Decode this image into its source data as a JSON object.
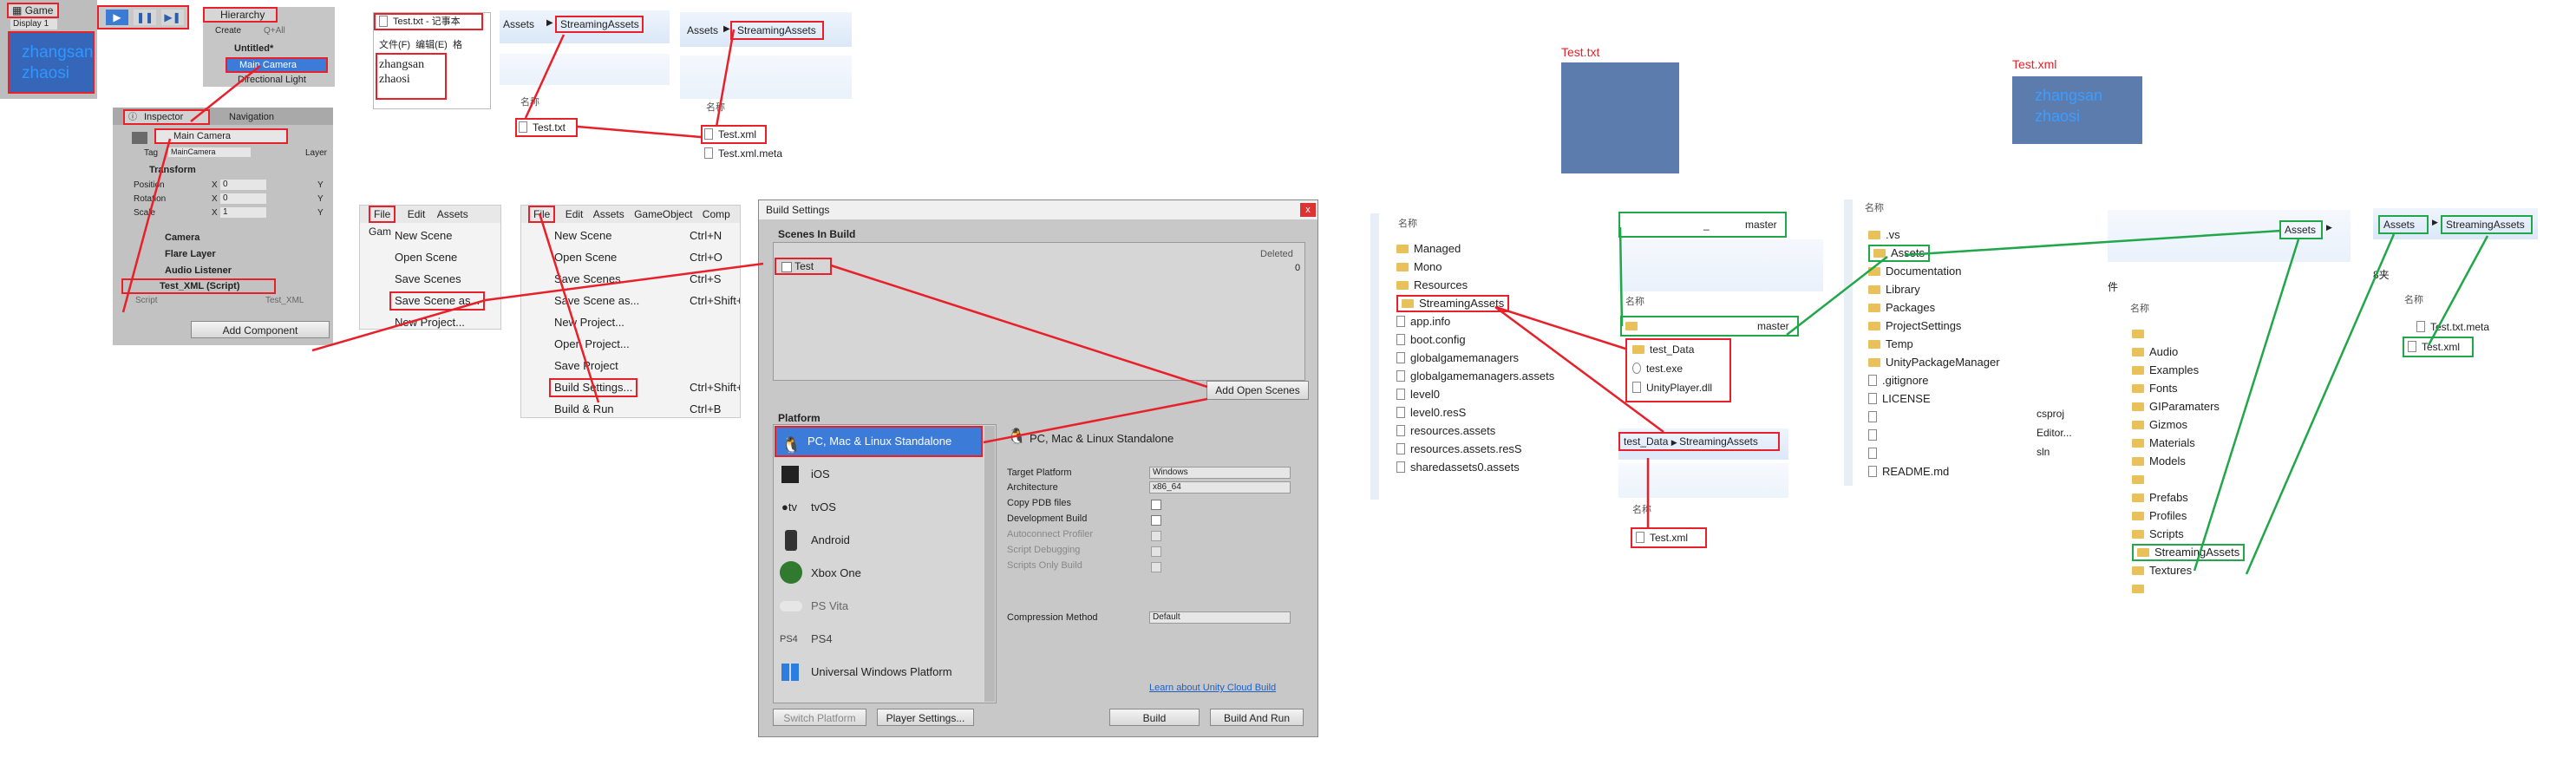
{
  "game": {
    "tab_label": "Game",
    "display_label": "Display 1",
    "text_lines": [
      "zhangsan",
      "zhaosi"
    ]
  },
  "hierarchy": {
    "title": "Hierarchy",
    "create_label": "Create",
    "search_label": "Q+All",
    "scene_name": "Untitled*",
    "items": [
      "Main Camera",
      "Directional Light"
    ]
  },
  "inspector": {
    "tabs": [
      "Inspector",
      "Navigation"
    ],
    "object_name": "Main Camera",
    "tag_label": "Tag",
    "tag_value": "MainCamera",
    "layer_label": "Layer",
    "transform_label": "Transform",
    "transform_rows": [
      {
        "label": "Position",
        "x": "0",
        "y": "Y"
      },
      {
        "label": "Rotation",
        "x": "0",
        "y": "Y"
      },
      {
        "label": "Scale",
        "x": "1",
        "y": "Y"
      }
    ],
    "x_label": "X",
    "components": [
      "Camera",
      "Flare Layer",
      "Audio Listener",
      "Test_XML (Script)"
    ],
    "script_label": "Script",
    "script_value": "Test_XML",
    "add_component_label": "Add Component"
  },
  "notepad": {
    "title": "Test.txt - 记事本",
    "menu": [
      "文件(F)",
      "编辑(E)",
      "格"
    ],
    "lines": [
      "zhangsan",
      "zhaosi"
    ]
  },
  "explorer_a": {
    "breadcrumb": [
      "Assets",
      "StreamingAssets"
    ],
    "column_label": "名称",
    "files": [
      "Test.txt"
    ]
  },
  "explorer_b": {
    "breadcrumb": [
      "Assets",
      "StreamingAssets"
    ],
    "column_label": "名称",
    "files": [
      "Test.xml",
      "Test.xml.meta"
    ]
  },
  "file_menu_a": {
    "menubar": [
      "File",
      "Edit",
      "Assets",
      "Gam"
    ],
    "items": [
      "New Scene",
      "Open Scene",
      "Save Scenes",
      "Save Scene as...",
      "New Project..."
    ]
  },
  "file_menu_b": {
    "menubar": [
      "File",
      "Edit",
      "Assets",
      "GameObject",
      "Comp"
    ],
    "items": [
      {
        "label": "New Scene",
        "shortcut": "Ctrl+N"
      },
      {
        "label": "Open Scene",
        "shortcut": "Ctrl+O"
      },
      {
        "label": "Save Scenes",
        "shortcut": "Ctrl+S"
      },
      {
        "label": "Save Scene as...",
        "shortcut": "Ctrl+Shift+S"
      },
      {
        "label": "New Project...",
        "shortcut": ""
      },
      {
        "label": "Open Project...",
        "shortcut": ""
      },
      {
        "label": "Save Project",
        "shortcut": ""
      },
      {
        "label": "Build Settings...",
        "shortcut": "Ctrl+Shift+B"
      },
      {
        "label": "Build & Run",
        "shortcut": "Ctrl+B"
      }
    ]
  },
  "build_settings": {
    "title": "Build Settings",
    "close_label": "x",
    "scenes_header": "Scenes In Build",
    "deleted_label": "Deleted",
    "scene_entry": "Test",
    "scene_index": "0",
    "add_open_scenes_label": "Add Open Scenes",
    "platform_header": "Platform",
    "platforms": [
      {
        "label": "PC, Mac & Linux Standalone",
        "icon": "pc-icon"
      },
      {
        "label": "iOS",
        "icon": "ios-icon"
      },
      {
        "label": "tvOS",
        "icon": "tvos-icon"
      },
      {
        "label": "Android",
        "icon": "android-icon"
      },
      {
        "label": "Xbox One",
        "icon": "xbox-icon"
      },
      {
        "label": "PS Vita",
        "icon": "psvita-icon"
      },
      {
        "label": "PS4",
        "icon": "ps4-icon"
      },
      {
        "label": "Universal Windows Platform",
        "icon": "windows-icon"
      }
    ],
    "selected_platform_title": "PC, Mac & Linux Standalone",
    "settings": [
      {
        "label": "Target Platform",
        "value": "Windows"
      },
      {
        "label": "Architecture",
        "value": "x86_64"
      },
      {
        "label": "Copy PDB files",
        "value": ""
      },
      {
        "label": "Development Build",
        "value": ""
      },
      {
        "label": "Autoconnect Profiler",
        "value": ""
      },
      {
        "label": "Script Debugging",
        "value": ""
      },
      {
        "label": "Scripts Only Build",
        "value": ""
      }
    ],
    "compression_label": "Compression Method",
    "compression_value": "Default",
    "cloud_link": "Learn about Unity Cloud Build",
    "switch_platform_label": "Switch Platform",
    "player_settings_label": "Player Settings...",
    "build_label": "Build",
    "build_and_run_label": "Build And Run"
  },
  "preview_txt": {
    "caption": "Test.txt"
  },
  "preview_xml": {
    "caption": "Test.xml",
    "lines": [
      "zhangsan",
      "zhaosi"
    ]
  },
  "build_output": {
    "column_label": "名称",
    "items": [
      {
        "label": "Managed",
        "type": "folder"
      },
      {
        "label": "Mono",
        "type": "folder"
      },
      {
        "label": "Resources",
        "type": "folder"
      },
      {
        "label": "StreamingAssets",
        "type": "folder"
      },
      {
        "label": "app.info",
        "type": "file"
      },
      {
        "label": "boot.config",
        "type": "file"
      },
      {
        "label": "globalgamemanagers",
        "type": "file"
      },
      {
        "label": "globalgamemanagers.assets",
        "type": "file"
      },
      {
        "label": "level0",
        "type": "file"
      },
      {
        "label": "level0.resS",
        "type": "file"
      },
      {
        "label": "resources.assets",
        "type": "file"
      },
      {
        "label": "resources.assets.resS",
        "type": "file"
      },
      {
        "label": "sharedassets0.assets",
        "type": "file"
      }
    ]
  },
  "master_path": {
    "label": "master",
    "prefix": "_"
  },
  "master_folder": {
    "column_label": "名称",
    "master_label": "master",
    "items": [
      {
        "label": "test_Data",
        "type": "folder"
      },
      {
        "label": "test.exe",
        "type": "exe"
      },
      {
        "label": "UnityPlayer.dll",
        "type": "file"
      }
    ]
  },
  "test_data_sa": {
    "breadcrumb": [
      "test_Data",
      "StreamingAssets"
    ],
    "column_label": "名称",
    "files": [
      "Test.xml"
    ]
  },
  "project_root": {
    "column_label": "名称",
    "items": [
      {
        "label": ".vs",
        "type": "folder"
      },
      {
        "label": "Assets",
        "type": "folder"
      },
      {
        "label": "Documentation",
        "type": "folder"
      },
      {
        "label": "Library",
        "type": "folder"
      },
      {
        "label": "Packages",
        "type": "folder"
      },
      {
        "label": "ProjectSettings",
        "type": "folder"
      },
      {
        "label": "Temp",
        "type": "folder"
      },
      {
        "label": "UnityPackageManager",
        "type": "folder"
      },
      {
        "label": ".gitignore",
        "type": "file"
      },
      {
        "label": "LICENSE",
        "type": "file"
      },
      {
        "label": "",
        "type": "file"
      },
      {
        "label": "",
        "type": "file"
      },
      {
        "label": "",
        "type": "file"
      },
      {
        "label": "README.md",
        "type": "file"
      }
    ],
    "right_labels": [
      "csproj",
      "Editor...",
      "sln"
    ]
  },
  "assets_folder": {
    "breadcrumb_label": "Assets",
    "column_label": "名称",
    "left_fragment": "件",
    "items": [
      "",
      "Audio",
      "Examples",
      "Fonts",
      "GIParamaters",
      "Gizmos",
      "Materials",
      "Models",
      "",
      "Prefabs",
      "Profiles",
      "Scripts",
      "StreamingAssets",
      "Textures",
      ""
    ]
  },
  "assets_sa": {
    "breadcrumb": [
      "Assets",
      "StreamingAssets"
    ],
    "left_fragment": "8夹",
    "column_label": "名称",
    "files": [
      "Test.txt.meta",
      "Test.xml"
    ]
  },
  "colors": {
    "highlight_red": "#e8202a",
    "highlight_green": "#22a64a",
    "selection_blue": "#3d7bd9"
  }
}
